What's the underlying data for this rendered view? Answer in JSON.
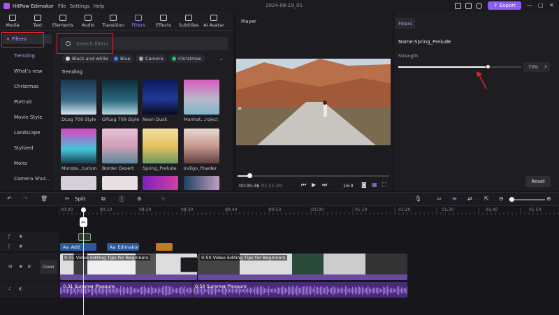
{
  "app": {
    "name": "HitPaw Edimakor",
    "menu": [
      "File",
      "Settings",
      "Help"
    ],
    "date": "2024-08-19_01",
    "export_label": "Export"
  },
  "tabs": [
    "Media",
    "Text",
    "Elements",
    "Audio",
    "Transition",
    "Filters",
    "Effects",
    "Subtitles",
    "AI Avatar"
  ],
  "categories": {
    "header": "Filters",
    "items": [
      "Trending",
      "What's new",
      "Christmas",
      "Portrait",
      "Movie Style",
      "Landscape",
      "Stylized",
      "Mono",
      "Camera Shut..."
    ]
  },
  "search": {
    "placeholder": "Search filters"
  },
  "chips": [
    "Black and white",
    "Blue",
    "Camera",
    "Christmas"
  ],
  "section_title": "Trending",
  "thumbnails": [
    "DLog 709 Style",
    "GPLog 709 Style",
    "Neon Dusk",
    "Manhat...roject",
    "Monste...turism",
    "Border Desert",
    "Spring_Prelude",
    "Indigo_Powder"
  ],
  "player": {
    "title": "Player",
    "current": "00:05:26",
    "total": "01:21:30",
    "ratio": "16:9"
  },
  "props": {
    "tab": "Filters",
    "name": "Name:Spring_Prelude",
    "strength_label": "Strength",
    "strength_value": "73%",
    "strength": 0.73,
    "reset": "Reset"
  },
  "toolbar": {
    "split": "Split"
  },
  "ruler": [
    "00:00",
    "00:10",
    "00:20",
    "00:30",
    "00:40",
    "00:50",
    "01:00",
    "01:10",
    "01:20",
    "01:30",
    "01:40",
    "01:50"
  ],
  "tracks": {
    "text1": "Add",
    "text2": "Edimakor",
    "cover": "Cover",
    "video1": "0:31 Video Editing Tips for Beginners",
    "video2": "0:50 Video Editing Tips for Beginners",
    "audio1": "0:31 Summer Pleasure",
    "audio2": "0:50 Summer Pleasure"
  }
}
